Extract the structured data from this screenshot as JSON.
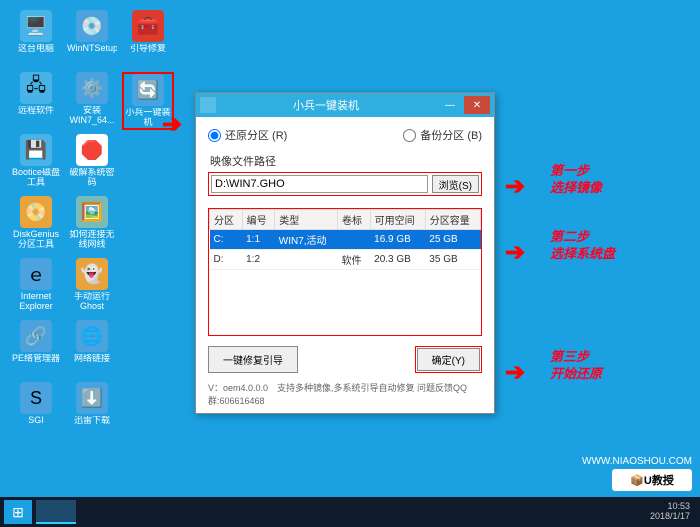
{
  "desktop": {
    "rows": [
      [
        "这台电脑",
        "WinNTSetup",
        "引导修复"
      ],
      [
        "远程软件",
        "安装WIN7_64...",
        "小兵一键装机"
      ],
      [
        "Bootice磁盘工具",
        "破解系统密码"
      ],
      [
        "DiskGenius分区工具",
        "如何连接无线网线"
      ],
      [
        "Internet Explorer",
        "手动运行Ghost"
      ],
      [
        "PE络管理器",
        "网络链接"
      ],
      [
        "SGI",
        "迅雷下载"
      ]
    ]
  },
  "dialog": {
    "title": "小兵一键装机",
    "radio_restore": "还原分区 (R)",
    "radio_backup": "备份分区 (B)",
    "path_label": "映像文件路径",
    "path_value": "D:\\WIN7.GHO",
    "browse": "浏览(S)",
    "columns": [
      "分区",
      "编号",
      "类型",
      "卷标",
      "可用空间",
      "分区容量"
    ],
    "rows": [
      {
        "p": "C:",
        "n": "1:1",
        "t": "WIN7,活动",
        "v": "",
        "free": "16.9 GB",
        "cap": "25 GB"
      },
      {
        "p": "D:",
        "n": "1:2",
        "t": "",
        "v": "软件",
        "free": "20.3 GB",
        "cap": "35 GB"
      }
    ],
    "repair": "一键修复引导",
    "ok": "确定(Y)",
    "footer": "V：oem4.0.0.0 支持多种镜像,多系统引导自动修复 问题反馈QQ群:606616468"
  },
  "annot": {
    "s1a": "第一步",
    "s1b": "选择镜像",
    "s2a": "第二步",
    "s2b": "选择系统盘",
    "s3a": "第三步",
    "s3b": "开始还原"
  },
  "taskbar": {
    "time": "10:53",
    "date": "2018/1/17"
  },
  "wm": {
    "text1": "WWW.NIAOSHOU.COM",
    "text2": "U教授"
  }
}
